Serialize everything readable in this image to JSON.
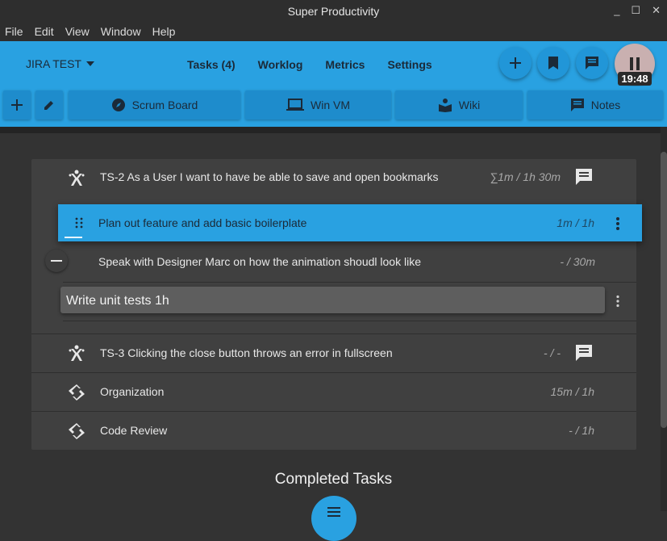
{
  "window": {
    "title": "Super Productivity",
    "controls": [
      "_",
      "☐",
      "✕"
    ]
  },
  "menu": [
    "File",
    "Edit",
    "View",
    "Window",
    "Help"
  ],
  "header": {
    "project": "JIRA TEST",
    "tabs": [
      "Tasks (4)",
      "Worklog",
      "Metrics",
      "Settings"
    ],
    "timer": "19:48"
  },
  "toolbar": {
    "buttons": [
      "Scrum Board",
      "Win VM",
      "Wiki",
      "Notes"
    ]
  },
  "tasks": [
    {
      "title": "TS-2 As a User I want to have be able to save and open bookmarks",
      "estimate": "∑1m / 1h 30m",
      "icon": "jira-icon",
      "has_note": true
    },
    {
      "title": "TS-3 Clicking the close button throws an error in fullscreen",
      "estimate": "- / -",
      "icon": "jira-icon",
      "has_note": true
    },
    {
      "title": "Organization",
      "estimate": "15m / 1h",
      "icon": "repeat-icon",
      "has_note": false
    },
    {
      "title": "Code Review",
      "estimate": "- / 1h",
      "icon": "repeat-icon",
      "has_note": false
    }
  ],
  "subtasks": [
    {
      "title": "Plan out feature and add basic boilerplate",
      "estimate": "1m / 1h"
    },
    {
      "title": "Speak with Designer Marc on how the animation shoudl look like",
      "estimate": "- / 30m"
    }
  ],
  "editing": {
    "value": "Write unit tests 1h"
  },
  "completed": {
    "title": "Completed Tasks"
  },
  "colors": {
    "accent": "#29a1e1",
    "background": "#333333",
    "panel": "#404040"
  }
}
